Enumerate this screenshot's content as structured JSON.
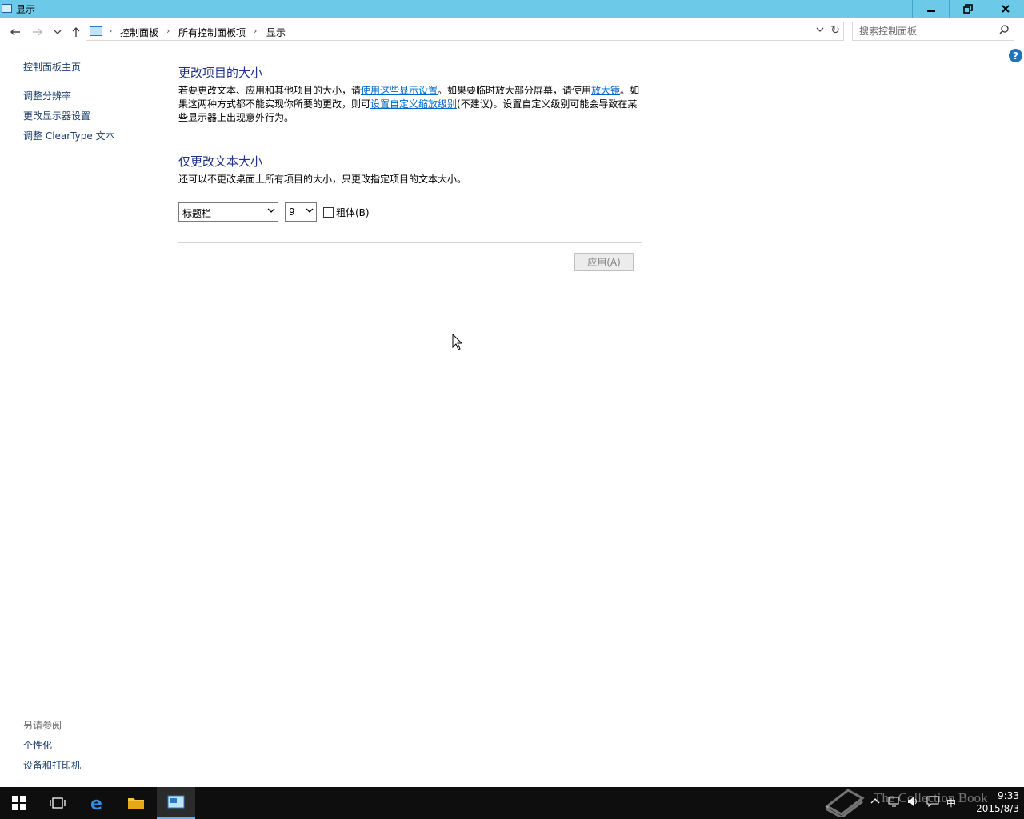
{
  "window": {
    "title": "显示"
  },
  "address": {
    "crumbs": [
      "控制面板",
      "所有控制面板项",
      "显示"
    ]
  },
  "search": {
    "placeholder": "搜索控制面板"
  },
  "sidebar": {
    "home": "控制面板主页",
    "links": [
      "调整分辨率",
      "更改显示器设置",
      "调整 ClearType 文本"
    ],
    "see_also": {
      "label": "另请参阅",
      "links": [
        "个性化",
        "设备和打印机"
      ]
    }
  },
  "main": {
    "section1": {
      "heading": "更改项目的大小",
      "text1": "若要更改文本、应用和其他项目的大小，请",
      "link1": "使用这些显示设置",
      "text2": "。如果要临时放大部分屏幕，请使用",
      "link2": "放大镜",
      "text3": "。如果这两种方式都不能实现你所要的更改，则可",
      "link3": "设置自定义缩放级别",
      "text4": "(不建议)。设置自定义级别可能会导致在某些显示器上出现意外行为。"
    },
    "section2": {
      "heading": "仅更改文本大小",
      "desc": "还可以不更改桌面上所有项目的大小，只更改指定项目的文本大小。",
      "item_select": "标题栏",
      "size_select": "9",
      "bold_label": "粗体(B)",
      "bold_checked": false
    },
    "apply_label": "应用(A)"
  },
  "help_icon": "?",
  "taskbar": {
    "time": "9:33",
    "date": "2015/8/3",
    "ime": "中"
  },
  "watermark": "The Collection Book"
}
